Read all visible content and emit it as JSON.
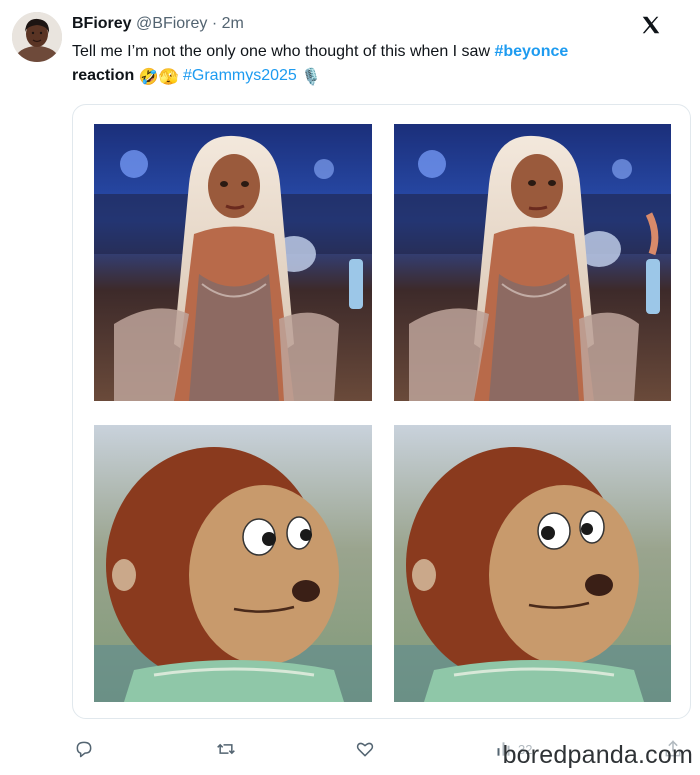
{
  "author": {
    "display_name": "BFiorey",
    "handle": "@BFiorey",
    "separator": "·",
    "time": "2m",
    "avatar_icon": "profile-photo"
  },
  "platform_icon": "x-logo-icon",
  "post": {
    "text_part1": "Tell me I’m not the only one who thought of this when I saw ",
    "hashtag1": "#beyonce",
    "text_part2": "reaction",
    "emoji1": "🤣",
    "emoji2": "🫣",
    "hashtag2": "#Grammys2025",
    "emoji3": "🎙️"
  },
  "media": {
    "panels": [
      {
        "subject": "side-eye-celebrity-photo"
      },
      {
        "subject": "side-eye-celebrity-photo"
      },
      {
        "subject": "puppet-looking-away"
      },
      {
        "subject": "puppet-side-glance"
      }
    ]
  },
  "actions": {
    "reply_icon": "reply-icon",
    "retweet_icon": "retweet-icon",
    "like_icon": "heart-icon",
    "views_icon": "views-icon",
    "views_count": "32",
    "share_icon": "share-icon"
  },
  "watermark": "boredpanda.com",
  "colors": {
    "link": "#1d9bf0",
    "muted": "#536471",
    "text": "#0f1419"
  }
}
